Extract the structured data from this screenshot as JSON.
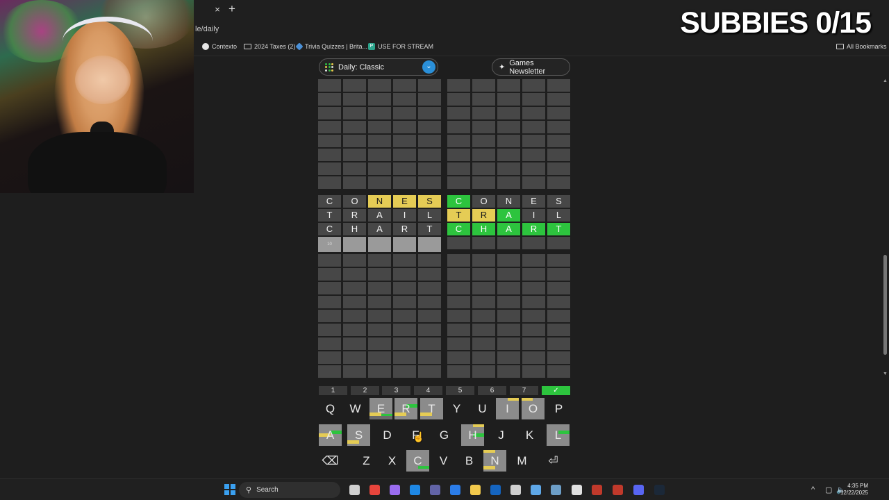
{
  "browser": {
    "tab_close": "×",
    "tab_new": "+",
    "url": "le/daily",
    "bookmarks": [
      {
        "label": "Contexto",
        "icon": "contexto-icon",
        "color": "#e6e6e6"
      },
      {
        "label": "2024 Taxes (2)",
        "icon": "folder-icon",
        "color": ""
      },
      {
        "label": "Trivia Quizzes | Brita...",
        "icon": "britannica-icon",
        "color": "#4a8fd6"
      },
      {
        "label": "USE FOR STREAM",
        "icon": "p-icon",
        "color": "#2ca58d"
      }
    ],
    "all_bookmarks": "All Bookmarks"
  },
  "overlay": {
    "subbies": "SUBBIES 0/15"
  },
  "header": {
    "mode_label": "Daily: Classic",
    "newsletter_label": "Games Newsletter"
  },
  "colors": {
    "green": "#2dc43e",
    "yellow": "#e5cc55",
    "empty_cell": "#474747",
    "used_key": "#8b8b8b",
    "accent_blue": "#2a8fd8"
  },
  "boards": {
    "left": {
      "guesses": [
        {
          "letters": [
            "C",
            "O",
            "N",
            "E",
            "S"
          ],
          "states": [
            "n",
            "n",
            "y",
            "y",
            "y"
          ]
        },
        {
          "letters": [
            "T",
            "R",
            "A",
            "I",
            "L"
          ],
          "states": [
            "n",
            "n",
            "n",
            "n",
            "n"
          ]
        },
        {
          "letters": [
            "C",
            "H",
            "A",
            "R",
            "T"
          ],
          "states": [
            "n",
            "n",
            "n",
            "n",
            "n"
          ]
        }
      ],
      "current_row_number": "10"
    },
    "right": {
      "guesses": [
        {
          "letters": [
            "C",
            "O",
            "N",
            "E",
            "S"
          ],
          "states": [
            "g",
            "n",
            "n",
            "n",
            "n"
          ]
        },
        {
          "letters": [
            "T",
            "R",
            "A",
            "I",
            "L"
          ],
          "states": [
            "y",
            "y",
            "g",
            "n",
            "n"
          ]
        },
        {
          "letters": [
            "C",
            "H",
            "A",
            "R",
            "T"
          ],
          "states": [
            "g",
            "g",
            "g",
            "g",
            "g"
          ]
        }
      ]
    }
  },
  "board_selector": [
    "1",
    "2",
    "3",
    "4",
    "5",
    "6",
    "7",
    "✓"
  ],
  "keyboard": {
    "rows": [
      [
        "Q",
        "W",
        "E",
        "R",
        "T",
        "Y",
        "U",
        "I",
        "O",
        "P"
      ],
      [
        "A",
        "S",
        "D",
        "F",
        "G",
        "H",
        "J",
        "K",
        "L"
      ],
      [
        "⌫",
        "Z",
        "X",
        "C",
        "V",
        "B",
        "N",
        "M",
        "⏎"
      ]
    ],
    "used_keys": [
      "E",
      "R",
      "T",
      "I",
      "O",
      "A",
      "S",
      "H",
      "L",
      "C",
      "N"
    ]
  },
  "taskbar": {
    "search_label": "Search",
    "time": "4:35 PM",
    "date": "12/22/2025"
  }
}
